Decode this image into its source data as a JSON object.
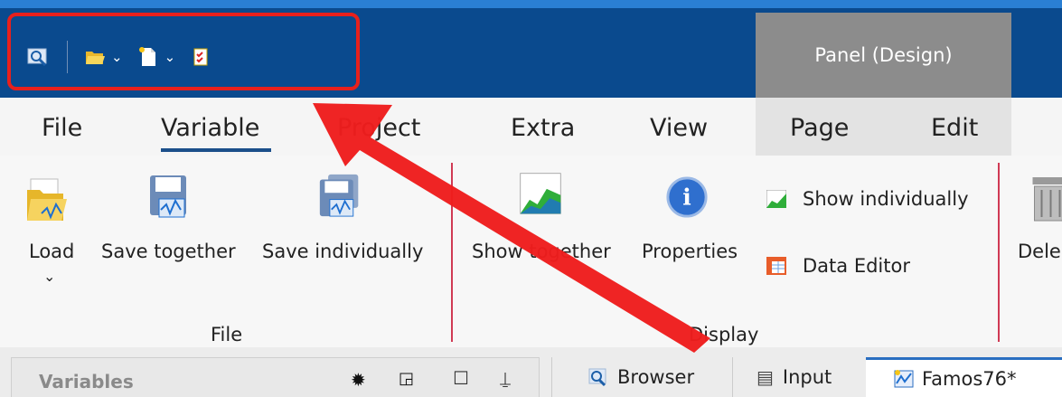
{
  "title_bar": {
    "context_tab": "Panel (Design)",
    "quick_access": {
      "icons": [
        "search-icon",
        "folder-open-icon",
        "new-document-icon",
        "checklist-icon"
      ]
    }
  },
  "ribbon": {
    "tabs": [
      "File",
      "Variable",
      "Project",
      "Extra",
      "View",
      "Page",
      "Edit"
    ],
    "active_tab": "Variable",
    "groups": {
      "file": {
        "title": "File",
        "buttons": [
          "Load",
          "Save together",
          "Save individually"
        ]
      },
      "display": {
        "title": "Display",
        "buttons": [
          "Show together",
          "Properties"
        ],
        "small_buttons": [
          "Show individually",
          "Data Editor"
        ]
      },
      "delete": {
        "button": "Dele"
      }
    }
  },
  "bottom": {
    "panel_title": "Variables",
    "tabs": [
      "Browser",
      "Input",
      "Famos76*"
    ]
  },
  "colors": {
    "title_bar": "#0a4a8e",
    "highlight": "#e8201c",
    "context_tab": "#8c8c8c",
    "active_underline": "#1b4f8a"
  }
}
